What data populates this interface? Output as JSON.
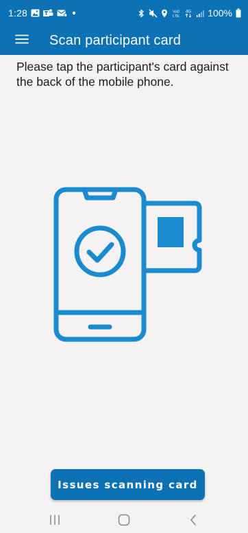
{
  "status_bar": {
    "time": "1:28",
    "battery": "100%",
    "icons_left": [
      "gallery-icon",
      "teams-icon",
      "mail-icon",
      "dot-icon"
    ],
    "icons_right": [
      "bluetooth-icon",
      "mute-icon",
      "location-icon",
      "volte-icon",
      "4g-icon",
      "signal-icon",
      "battery-icon"
    ],
    "volte_label": "Vo0 LTE",
    "network_label": "4G"
  },
  "app_bar": {
    "title": "Scan participant card",
    "menu_icon": "menu-icon"
  },
  "main": {
    "instructions": "Please tap the participant's card against the back of the mobile phone.",
    "illustration_icon": "phone-tap-card-icon",
    "issues_button_label": "Issues scanning card"
  },
  "nav_bar": {
    "icons": [
      "recent-apps-icon",
      "home-icon",
      "back-icon"
    ]
  },
  "colors": {
    "primary": "#0d72b5",
    "illustration": "#1b8bcf",
    "background": "#f4f2f2"
  }
}
